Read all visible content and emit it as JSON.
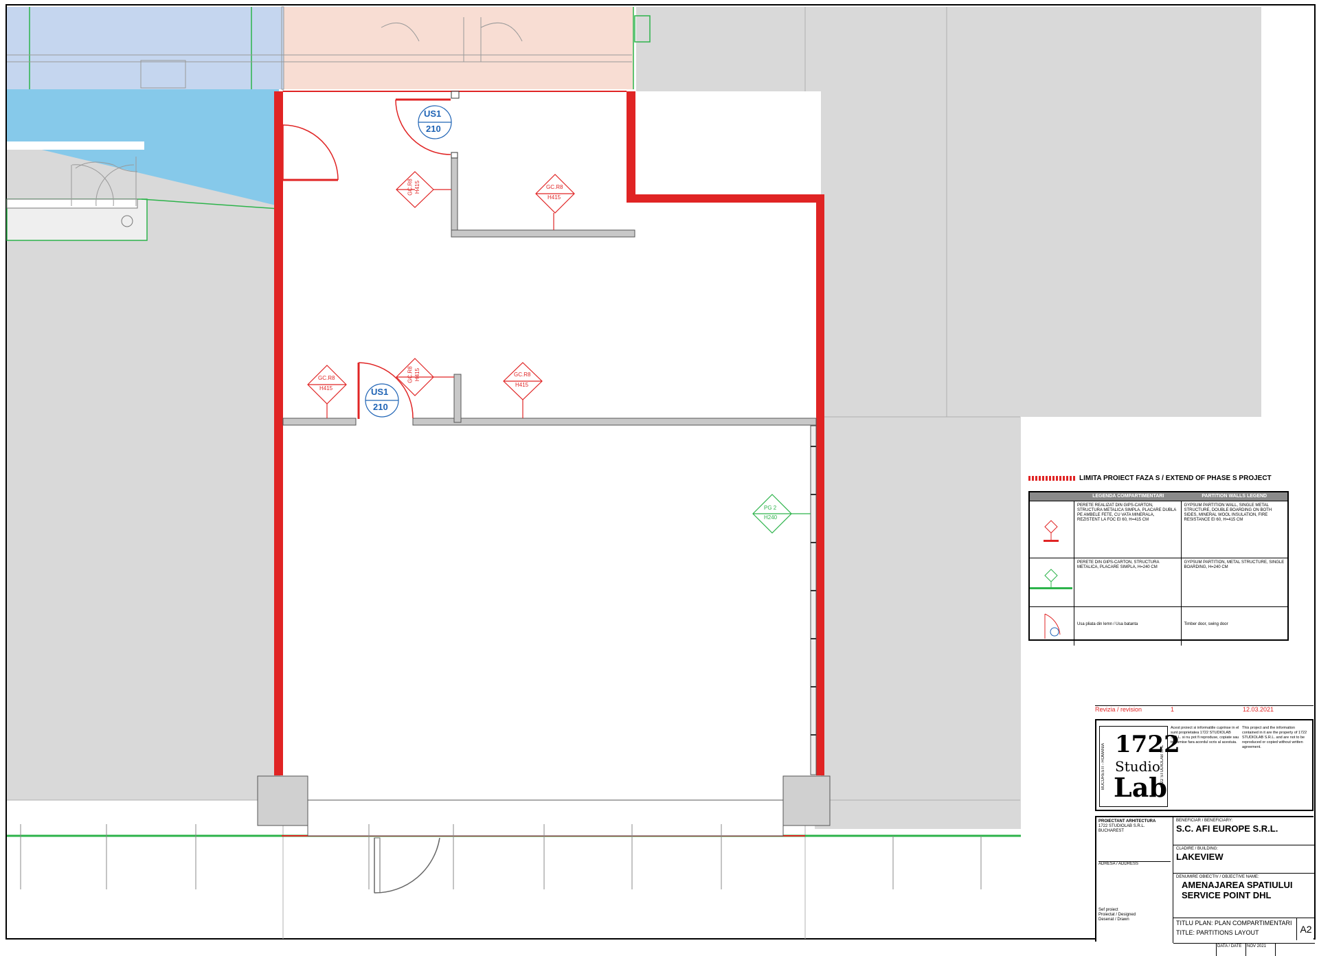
{
  "tags": {
    "door_type": "US1",
    "door_width": "210",
    "wall_type": "GC.R8",
    "wall_height": "H415",
    "partition_type": "PG 2",
    "partition_height": "H240"
  },
  "legend": {
    "limit_title": "LIMITA PROIECT FAZA S / EXTEND OF PHASE S PROJECT",
    "col1_header": "LEGENDA COMPARTIMENTARI",
    "col2_header": "PARTITION WALLS LEGEND",
    "rows": [
      {
        "ro": "PERETE REALIZAT DIN GIPS-CARTON, STRUCTURA METALICA SIMPLA, PLACARE DUBLA PE AMBELE FETE, CU VATA MINERALA, REZISTENT LA FOC EI 60, H=415 CM",
        "en": "GYPSUM PARTITION WALL, SINGLE METAL STRUCTURE, DOUBLE BOARDING ON BOTH SIDES, MINERAL WOOL INSULATION, FIRE RESISTANCE EI 60, H=415 CM"
      },
      {
        "ro": "PERETE DIN GIPS-CARTON, STRUCTURA METALICA, PLACARE SIMPLA, H=240 CM",
        "en": "GYPSUM PARTITION, METAL STRUCTURE, SINGLE BOARDING, H=240 CM"
      },
      {
        "ro": "Usa pliata din lemn / Usa batanta",
        "en": "Timber door, swing door"
      }
    ]
  },
  "titleblock": {
    "revision_label": "Revizia / revision",
    "revision_no": "1",
    "revision_date": "12.03.2021",
    "logo_num": "1722",
    "logo_studio": "Studio",
    "logo_lab": "Lab",
    "logo_side_left": "BUCURESTI - ROMANIA",
    "logo_side_right": "1722 STUDIOLAB SRL",
    "note_ro": "Acest proiect si informatiile cuprinse in el sunt proprietatea 1722 STUDIOLAB S.R.L. si nu pot fi reproduse, copiate sau transmise fara acordul scris al acestuia.",
    "note_en": "This project and the information contained in it are the property of 1722 STUDIOLAB S.R.L. and are not to be reproduced or copied without written agreement.",
    "architect_label": "PROIECTANT ARHITECTURA",
    "architect_name": "1722 STUDIOLAB S.R.L.",
    "architect_city": "BUCHAREST",
    "address_label": "ADRESA / ADDRESS",
    "beneficiary_label": "BENEFICIAR / BENEFICIARY:",
    "beneficiary": "S.C. AFI EUROPE S.R.L.",
    "building_label": "CLADIRE / BUILDING:",
    "building": "LAKEVIEW",
    "objective_label": "DENUMIRE OBIECTIV / OBJECTIVE NAME:",
    "objective_line1": "AMENAJAREA SPATIULUI",
    "objective_line2": "SERVICE POINT DHL",
    "title_ro": "TITLU PLAN: PLAN COMPARTIMENTARI",
    "title_en": "TITLE: PARTITIONS LAYOUT",
    "sheet_format": "A2",
    "project_chief": "Sef proiect",
    "designed": "Proiectat / Designed",
    "drawn": "Desenat / Drawn",
    "date_label": "DATA / DATE",
    "date_value": "NOV 2021"
  },
  "colors": {
    "limit_red": "#e02424",
    "wall_gray": "#c8c8c8",
    "bg_gray": "#d9d9d9",
    "blue_zone": "#c5d6ef",
    "cyan_zone": "#86c9ea",
    "salmon_zone": "#f8ddd3",
    "tag_green": "#2cb34a",
    "tag_blue": "#1e63b5"
  }
}
